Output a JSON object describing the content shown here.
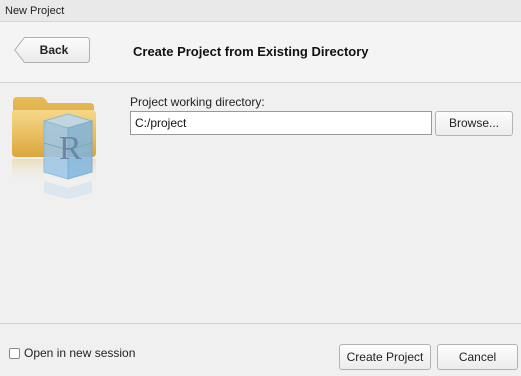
{
  "window": {
    "title": "New Project"
  },
  "header": {
    "back_label": "Back",
    "title": "Create Project from Existing Directory"
  },
  "main": {
    "icon": "folder-r-project-icon",
    "dir_label": "Project working directory:",
    "dir_value": "C:/project",
    "browse_label": "Browse..."
  },
  "footer": {
    "new_session_label": "Open in new session",
    "new_session_checked": false,
    "create_label": "Create Project",
    "cancel_label": "Cancel"
  },
  "colors": {
    "folder": "#e8b84a",
    "r_cube": "#7fb6e0"
  }
}
